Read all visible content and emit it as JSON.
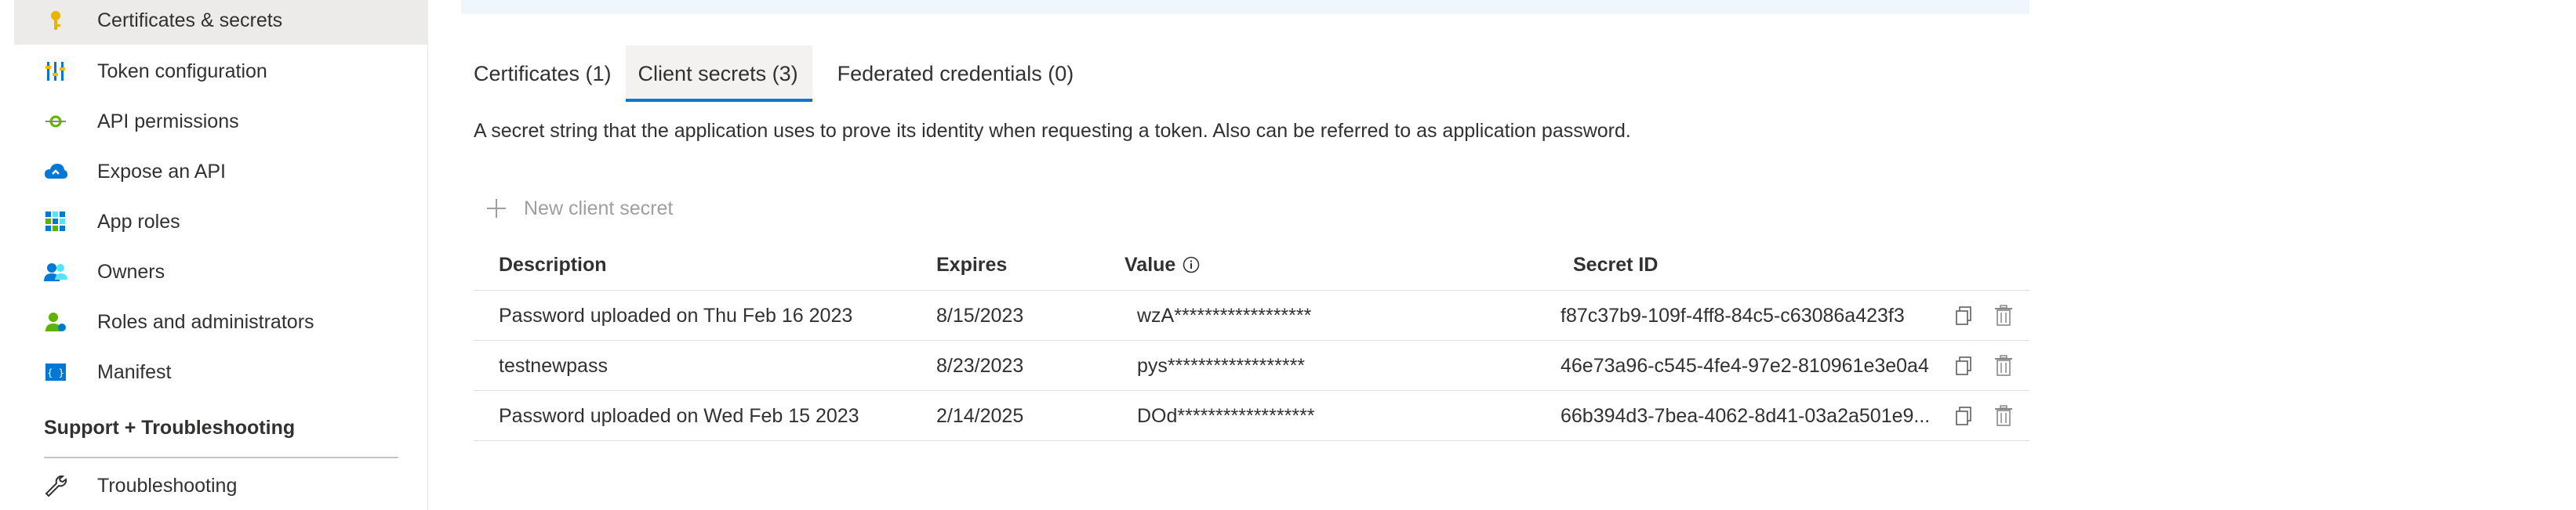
{
  "sidebar": {
    "items": [
      {
        "label": "Certificates & secrets",
        "icon": "key-icon",
        "active": true
      },
      {
        "label": "Token configuration",
        "icon": "token-config-icon",
        "active": false
      },
      {
        "label": "API permissions",
        "icon": "api-permissions-icon",
        "active": false
      },
      {
        "label": "Expose an API",
        "icon": "cloud-icon",
        "active": false
      },
      {
        "label": "App roles",
        "icon": "app-roles-grid-icon",
        "active": false
      },
      {
        "label": "Owners",
        "icon": "people-icon",
        "active": false
      },
      {
        "label": "Roles and administrators",
        "icon": "admin-person-icon",
        "active": false
      },
      {
        "label": "Manifest",
        "icon": "manifest-icon",
        "active": false
      }
    ],
    "section_title": "Support + Troubleshooting",
    "support_items": [
      {
        "label": "Troubleshooting",
        "icon": "wrench-icon"
      }
    ]
  },
  "tabs": [
    {
      "label": "Certificates (1)",
      "selected": false
    },
    {
      "label": "Client secrets (3)",
      "selected": true
    },
    {
      "label": "Federated credentials (0)",
      "selected": false
    }
  ],
  "description": "A secret string that the application uses to prove its identity when requesting a token. Also can be referred to as application password.",
  "toolbar": {
    "new_secret_label": "New client secret"
  },
  "table": {
    "headers": {
      "description": "Description",
      "expires": "Expires",
      "value": "Value",
      "secret_id": "Secret ID"
    },
    "rows": [
      {
        "description": "Password uploaded on Thu Feb 16 2023",
        "expires": "8/15/2023",
        "value": "wzA******************",
        "secret_id": "f87c37b9-109f-4ff8-84c5-c63086a423f3"
      },
      {
        "description": "testnewpass",
        "expires": "8/23/2023",
        "value": "pys******************",
        "secret_id": "46e73a96-c545-4fe4-97e2-810961e3e0a4"
      },
      {
        "description": "Password uploaded on Wed Feb 15 2023",
        "expires": "2/14/2025",
        "value": "DOd******************",
        "secret_id": "66b394d3-7bea-4062-8d41-03a2a501e9..."
      }
    ]
  },
  "colors": {
    "accent": "#0078d4",
    "active_nav_bg": "#edebe9",
    "banner_bg": "#eff6fc",
    "disabled_text": "#a19f9d",
    "key_icon": "#e8b400"
  }
}
